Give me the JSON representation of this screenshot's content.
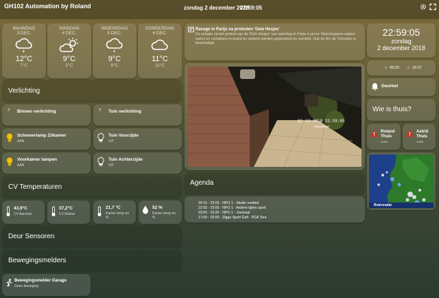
{
  "header": {
    "title": "GH102 Automation by Roland",
    "date": "zondag 2 december 2018",
    "time": "22:59:05",
    "icons": [
      "gear-icon",
      "fullscreen-icon"
    ]
  },
  "weather": [
    {
      "day": "MAANDAG",
      "date": "3 DEC.",
      "temp": "12°C",
      "low": "7°C",
      "icon": "cloud-rain"
    },
    {
      "day": "DINSDAG",
      "date": "4 DEC.",
      "temp": "9°C",
      "low": "5°C",
      "icon": "sun-cloud"
    },
    {
      "day": "WOENSDAG",
      "date": "5 DEC.",
      "temp": "9°C",
      "low": "8°C",
      "icon": "cloud-rain"
    },
    {
      "day": "DONDERDAG",
      "date": "6 DEC.",
      "temp": "11°C",
      "low": "11°C",
      "icon": "cloud"
    }
  ],
  "news": {
    "title": "Ravage in Parijs na protesten 'Gele Hesjes'",
    "body": "De schade na het protest van de 'Gele Hesjes' van zaterdag in Parijs is groot. Relschoppers staken auto's en containers in brand en winkels werden geplunderd en vernield. Ook de Arc de Triomphe is beschadigd."
  },
  "camera": {
    "overlay_date": "02-12-2018  22:59:05",
    "overlay_name": "Voordeur"
  },
  "clock": {
    "time": "22:59:05",
    "day": "zondag",
    "date": "2 december 2018",
    "sunrise": "08:29",
    "sunset": "16:37"
  },
  "doorbell": {
    "label": "Deurbel"
  },
  "who_home": {
    "title": "Wie is thuis?",
    "people": [
      {
        "name": "Roland Thuis",
        "state": "AAN"
      },
      {
        "name": "Astrid Thuis",
        "state": "AAN"
      }
    ]
  },
  "radar": {
    "label": "Buienradar"
  },
  "lighting": {
    "title": "Verlichting",
    "groups": [
      {
        "label": "Binnen verlichting"
      },
      {
        "label": "Tuin verlichting"
      }
    ],
    "switches": [
      {
        "name": "Schemerlamp Zitkamer",
        "state": "AAN"
      },
      {
        "name": "Tuin Voorzijde",
        "state": "UIT"
      },
      {
        "name": "Voorkamer lampen",
        "state": "AAN"
      },
      {
        "name": "Tuin Achterzijde",
        "state": "UIT"
      }
    ]
  },
  "cv": {
    "title": "CV Temperaturen",
    "tiles": [
      {
        "value": "43,9°C",
        "label": "CV Aanvoer"
      },
      {
        "value": "37,2°C",
        "label": "CV Retour"
      },
      {
        "value": "21,7 °C",
        "label": "Kamer temp en %"
      },
      {
        "value": "52 %",
        "label": "Kamer temp en %"
      }
    ]
  },
  "agenda": {
    "title": "Agenda",
    "items": [
      "20:15 - 23:05 · NPO 1 · Studio voetbal",
      "22:55 - 23:05 · NPO 1 · Andere tijden sport",
      "23:05 - 23:35 · NPO 1 · Journaal",
      "17:00 - 02:00 · Ziggo Sport Golf · PGA Tour"
    ]
  },
  "door": {
    "title": "Deur Sensoren"
  },
  "motion": {
    "title": "Bewegingsmelders",
    "sensor": {
      "name": "Bewegingsmelder Garage",
      "state": "Geen beweging"
    }
  },
  "colors": {
    "alert": "#c0392b",
    "bulb_on": "#f2c200"
  }
}
